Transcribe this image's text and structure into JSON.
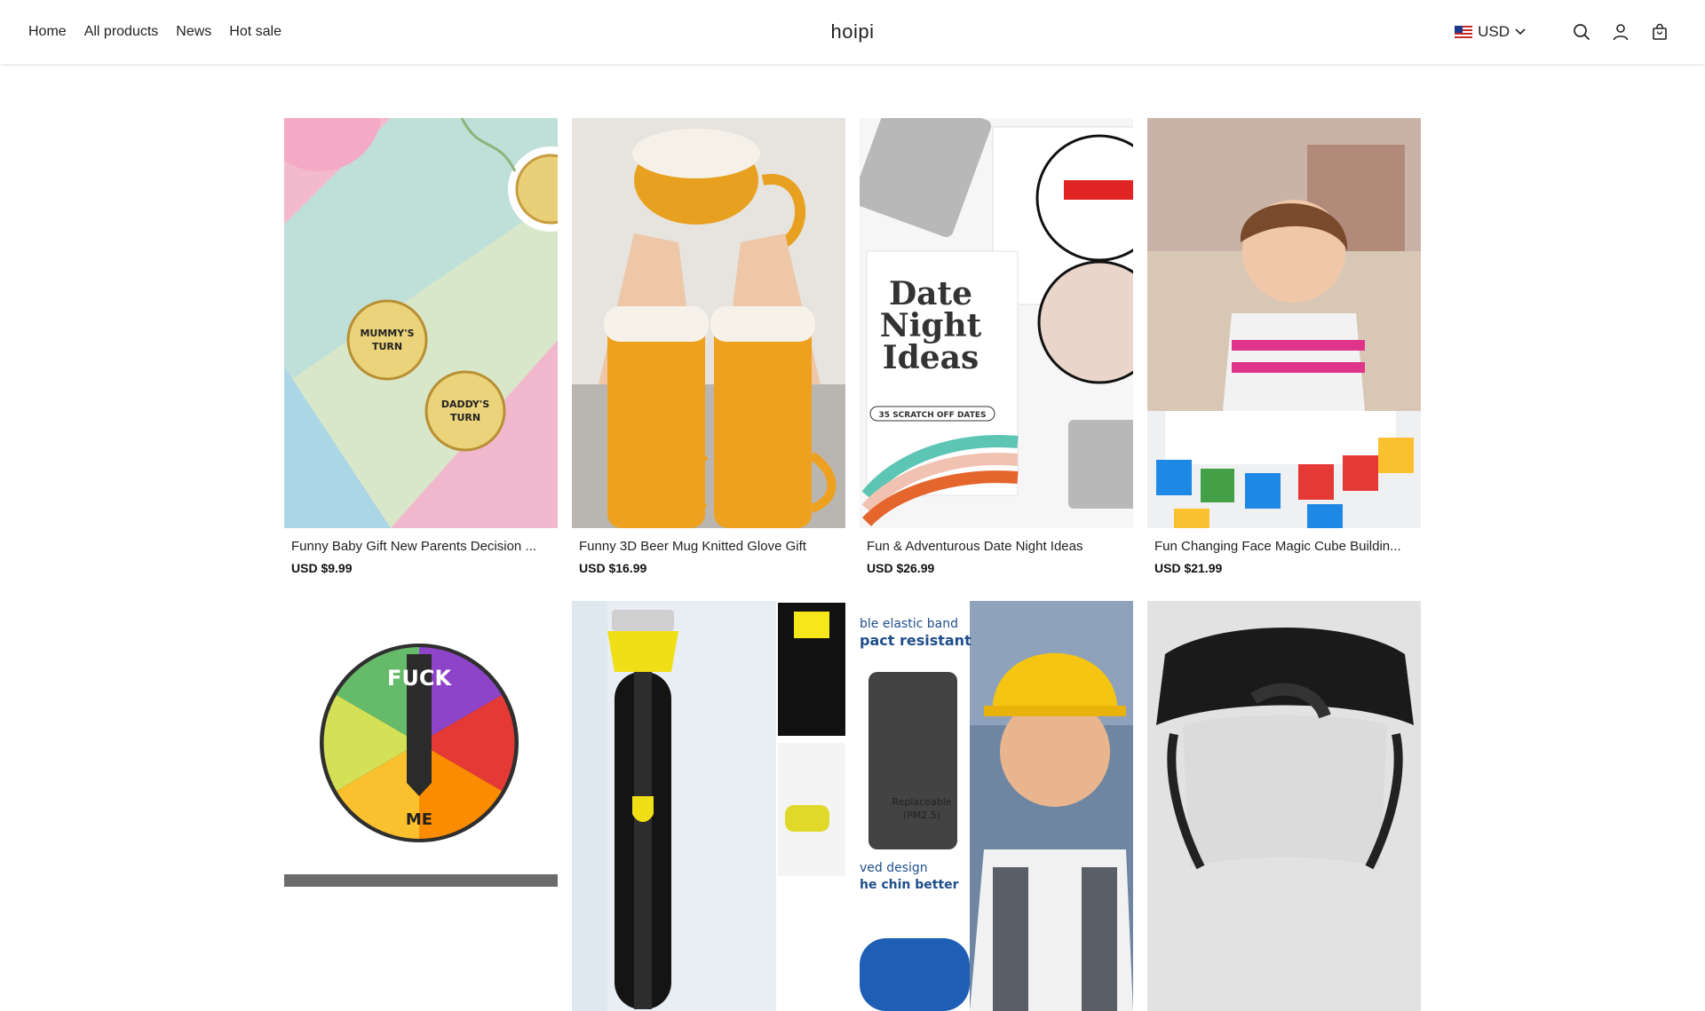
{
  "nav": {
    "items": [
      {
        "label": "Home"
      },
      {
        "label": "All products"
      },
      {
        "label": "News"
      },
      {
        "label": "Hot sale"
      }
    ]
  },
  "brand": {
    "name": "hoipi"
  },
  "currency": {
    "code": "USD",
    "flag": "us-flag-icon"
  },
  "icons": [
    "search-icon",
    "account-icon",
    "cart-icon"
  ],
  "products": [
    {
      "title": "Funny Baby Gift New Parents Decision ...",
      "price": "USD $9.99",
      "coin1": "MUMMY'S TURN",
      "coin2": "DADDY'S TURN"
    },
    {
      "title": "Funny 3D Beer Mug Knitted Glove Gift",
      "price": "USD $16.99"
    },
    {
      "title": "Fun & Adventurous Date Night Ideas",
      "price": "USD $26.99",
      "card_line1": "Date",
      "card_line2": "Night",
      "card_line3": "Ideas",
      "card_tag": "35 SCRATCH OFF DATES"
    },
    {
      "title": "Fun Changing Face Magic Cube Buildin...",
      "price": "USD $21.99"
    },
    {
      "title": "",
      "price": "",
      "pin_word": "FUCK",
      "pin_bottom": "ME"
    },
    {
      "title": "",
      "price": ""
    },
    {
      "title": "",
      "price": "",
      "text1": "ble elastic band",
      "text2": "pact resistant",
      "text3": "Replaceable",
      "text4": "(PM2.5)",
      "text5": "ved design",
      "text6": "he chin better"
    },
    {
      "title": "",
      "price": ""
    }
  ],
  "colors": {
    "accent": "#111111",
    "header_bg": "#ffffff"
  }
}
